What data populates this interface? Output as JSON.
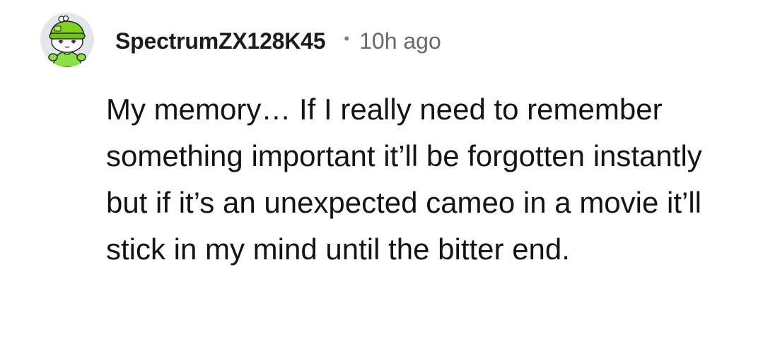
{
  "comment": {
    "author": "SpectrumZX128K45",
    "separator": "•",
    "timestamp": "10h ago",
    "body": "My memory… If I really need to remember something important it’ll be forgotten instantly but if it’s an unexpected cameo in a movie it’ll stick in my mind until the bitter end.",
    "avatar_icon": "snoo-avatar-green-beanie-icon"
  },
  "colors": {
    "avatar_bg": "#e4e8ec",
    "hat": "#7ed321",
    "shirt": "#8be043",
    "author_text": "#1c1c1c",
    "meta_text": "#666a70",
    "body_text": "#141414"
  }
}
